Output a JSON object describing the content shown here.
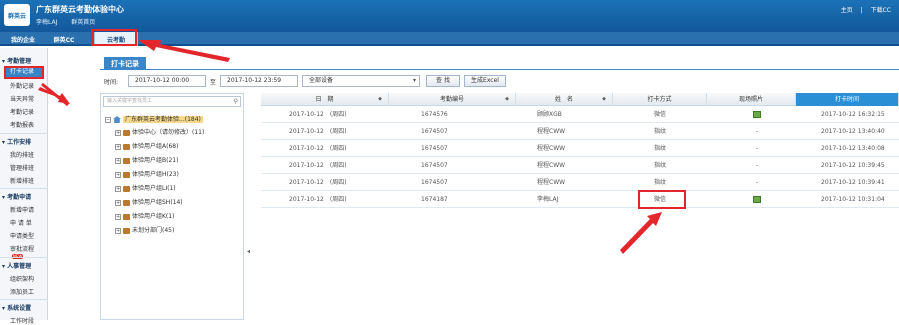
{
  "header": {
    "logo_text": "群英云",
    "title": "广东群英云考勤体验中心",
    "user": "李梅LAJ",
    "home_link": "群英首页",
    "links": [
      "主页",
      "下载CC"
    ]
  },
  "nav": {
    "tabs": [
      "我的企业",
      "群英CC",
      "云考勤"
    ]
  },
  "sidebar": {
    "groups": [
      {
        "title": "考勤管理",
        "items": [
          "打卡记录",
          "外勤记录",
          "当天异常",
          "考勤记录",
          "考勤报表"
        ]
      },
      {
        "title": "工作安排",
        "items": [
          "我的排班",
          "管理排班",
          "新增排班"
        ]
      },
      {
        "title": "考勤申请",
        "items": [
          "新增申请",
          "申 请 单",
          "申请类型",
          "审批流程"
        ]
      },
      {
        "title": "人事管理",
        "items": [
          "组织架构",
          "添加员工"
        ]
      },
      {
        "title": "系统设置",
        "items": [
          "工作时段"
        ]
      }
    ],
    "new_badge": "NEW"
  },
  "page": {
    "tab_label": "打卡记录"
  },
  "filter": {
    "time_label": "时间:",
    "start_date": "2017-10-12 00:00",
    "to_label": "至",
    "end_date": "2017-10-12 23:59",
    "device_value": "全部设备",
    "search_button": "查 找",
    "excel_button": "生成Excel"
  },
  "tree": {
    "search_placeholder": "输入关键字查找员工",
    "root": "广东群英云考勤体验...(184)",
    "nodes": [
      "体验中心（请勿修改）(11)",
      "体验用户组A(68)",
      "体验用户组B(21)",
      "体验用户组H(23)",
      "体验用户组LI(1)",
      "体验用户组SH(14)",
      "体验用户组K(1)",
      "未划分部门(45)"
    ]
  },
  "table": {
    "columns": [
      "日　期",
      "考勤编号",
      "姓　名",
      "打卡方式",
      "现场照片",
      "打卡时间"
    ],
    "rows": [
      {
        "date": "2017-10-12　(周四)",
        "code": "1674576",
        "name": "顾顾XGB",
        "method": "微信",
        "photo": "image",
        "time": "2017-10-12 16:32:15"
      },
      {
        "date": "2017-10-12　(周四)",
        "code": "1674507",
        "name": "程程CWW",
        "method": "指纹",
        "photo": "-",
        "time": "2017-10-12 13:40:40"
      },
      {
        "date": "2017-10-12　(周四)",
        "code": "1674507",
        "name": "程程CWW",
        "method": "指纹",
        "photo": "-",
        "time": "2017-10-12 13:40:08"
      },
      {
        "date": "2017-10-12　(周四)",
        "code": "1674507",
        "name": "程程CWW",
        "method": "指纹",
        "photo": "-",
        "time": "2017-10-12 10:39:45"
      },
      {
        "date": "2017-10-12　(周四)",
        "code": "1674507",
        "name": "程程CWW",
        "method": "指纹",
        "photo": "-",
        "time": "2017-10-12 10:39:41"
      },
      {
        "date": "2017-10-12　(周四)",
        "code": "1674187",
        "name": "李梅LAJ",
        "method": "微信",
        "photo": "image",
        "time": "2017-10-12 10:31:04"
      }
    ]
  },
  "colors": {
    "header_blue": "#1b72b8",
    "highlight_red": "#e3262b",
    "sorted_column": "#2b8fd6"
  }
}
